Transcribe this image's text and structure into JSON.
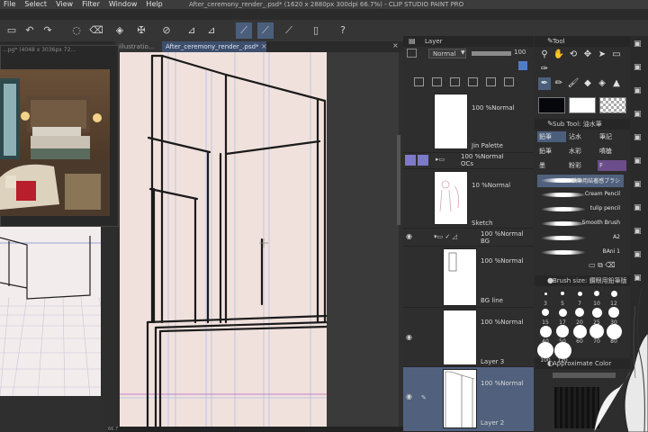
{
  "menubar": {
    "items": [
      "File",
      "Select",
      "View",
      "Filter",
      "Window",
      "Help"
    ]
  },
  "title": "After_ceremony_render_.psd* (1620 x 2880px 300dpi 66.7%)  - CLIP STUDIO PAINT PRO",
  "tabs": [
    {
      "label": "illustratio..."
    },
    {
      "label": "After_ceremony_render_.psd*"
    }
  ],
  "subview": {
    "title": "...pg* (4048 x 3036px 72..."
  },
  "status": {
    "zoom": "66.7"
  },
  "layer_panel": {
    "title": "Layer",
    "blend_mode": "Normal",
    "opacity": "100",
    "layers": [
      {
        "mode": "100 %Normal",
        "name": "Jin Palette"
      },
      {
        "mode": "100 %Normal",
        "name": "OCs"
      },
      {
        "mode": "10 %Normal",
        "name": "Sketch"
      },
      {
        "mode": "100 %Normal",
        "name": "BG"
      },
      {
        "mode": "100 %Normal",
        "name": "BG line"
      },
      {
        "mode": "100 %Normal",
        "name": "Layer 3"
      },
      {
        "mode": "100 %Normal",
        "name": "Layer 2"
      }
    ]
  },
  "tool_panel": {
    "title": "Tool",
    "subtool_title": "Sub Tool: 油水筆",
    "subtool_tabs": [
      "鉛筆",
      "沾水",
      "筆記",
      "鉛筆",
      "水彩",
      "噴槍",
      "墨",
      "粉彩",
      "F"
    ],
    "brushes": [
      {
        "name": "鉄筆用結著感ブラシ"
      },
      {
        "name": "Cream Pencil"
      },
      {
        "name": "tulip pencil"
      },
      {
        "name": "Smooth Brush"
      },
      {
        "name": "A2"
      },
      {
        "name": "BAni 1"
      }
    ],
    "brush_size_title": "Brush size: 鑽眼用鉛筆版",
    "brush_sizes": [
      "3",
      "5",
      "7",
      "10",
      "12",
      "15",
      "17",
      "20",
      "25",
      "30",
      "40",
      "50",
      "60",
      "70",
      "80",
      "100",
      "120"
    ],
    "color_title": "Approximate Color"
  },
  "icons": {
    "undo": "undo-arrow-icon",
    "redo": "redo-arrow-icon",
    "eye": "eye-icon",
    "folder": "folder-icon"
  }
}
